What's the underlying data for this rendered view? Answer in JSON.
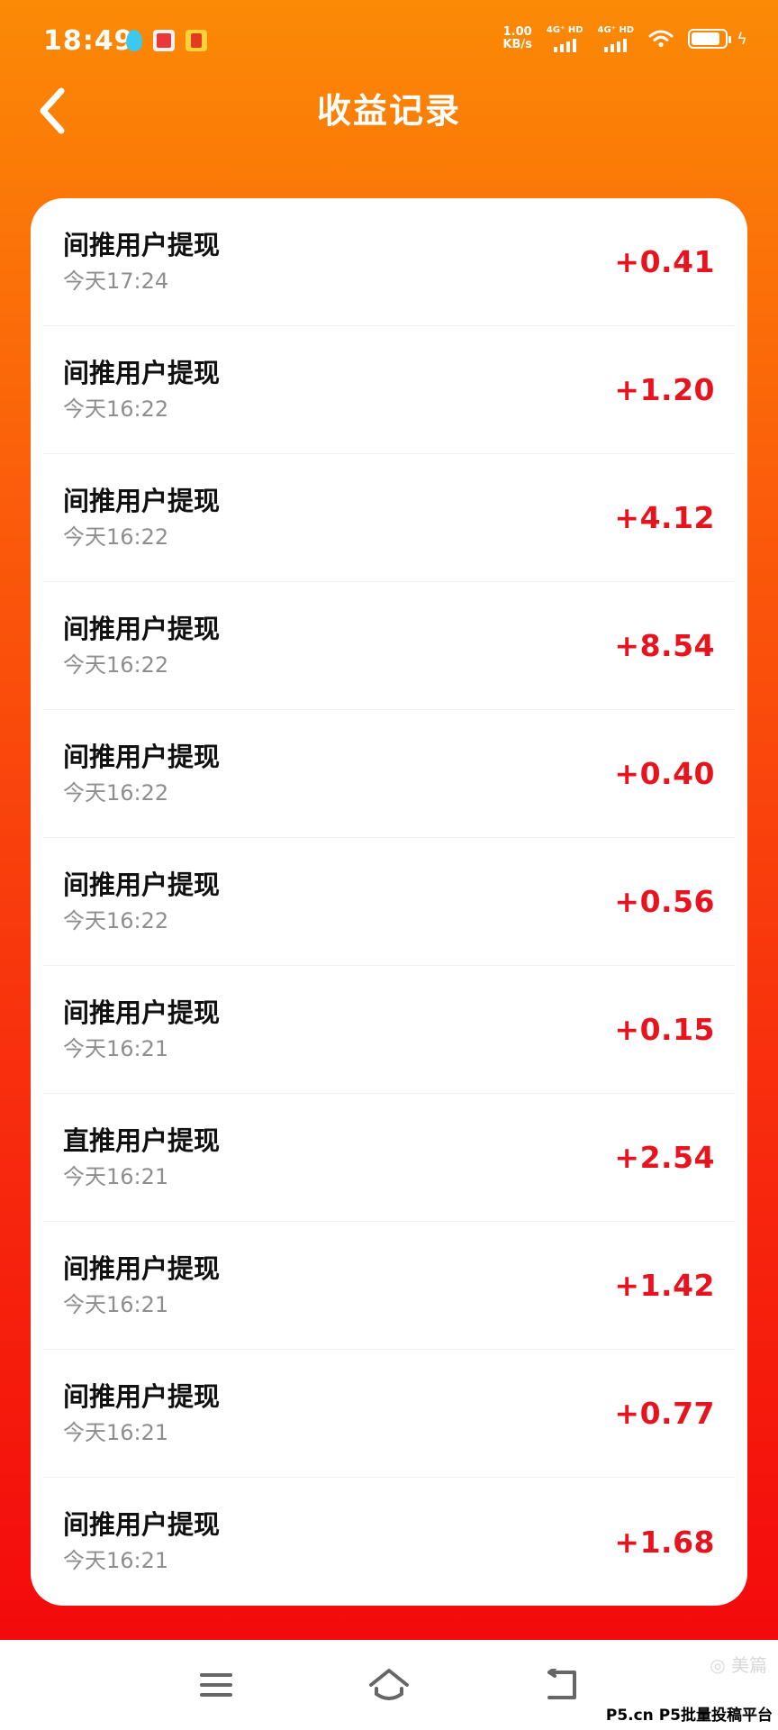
{
  "status_bar": {
    "time": "18:49",
    "net_speed_value": "1.00",
    "net_speed_unit": "KB/s",
    "sim1_label": "4G⁺ HD",
    "sim2_label": "4G⁺ HD",
    "battery_level": 0.85,
    "icons": [
      "water-drop-icon",
      "app-notification-icon",
      "app-notification-icon",
      "wifi-icon",
      "battery-icon",
      "charging-icon"
    ]
  },
  "header": {
    "title": "收益记录",
    "back_icon": "chevron-left-icon"
  },
  "records": [
    {
      "title": "间推用户提现",
      "time": "今天17:24",
      "amount": "+0.41"
    },
    {
      "title": "间推用户提现",
      "time": "今天16:22",
      "amount": "+1.20"
    },
    {
      "title": "间推用户提现",
      "time": "今天16:22",
      "amount": "+4.12"
    },
    {
      "title": "间推用户提现",
      "time": "今天16:22",
      "amount": "+8.54"
    },
    {
      "title": "间推用户提现",
      "time": "今天16:22",
      "amount": "+0.40"
    },
    {
      "title": "间推用户提现",
      "time": "今天16:22",
      "amount": "+0.56"
    },
    {
      "title": "间推用户提现",
      "time": "今天16:21",
      "amount": "+0.15"
    },
    {
      "title": "直推用户提现",
      "time": "今天16:21",
      "amount": "+2.54"
    },
    {
      "title": "间推用户提现",
      "time": "今天16:21",
      "amount": "+1.42"
    },
    {
      "title": "间推用户提现",
      "time": "今天16:21",
      "amount": "+0.77"
    },
    {
      "title": "间推用户提现",
      "time": "今天16:21",
      "amount": "+1.68"
    }
  ],
  "nav_bar": {
    "icons": [
      "menu-icon",
      "home-icon",
      "back-icon"
    ]
  },
  "watermark": {
    "logo_text": "美篇",
    "text": "P5.cn P5批量投稿平台"
  },
  "colors": {
    "gradient_top": "#fb8a06",
    "gradient_bottom": "#f30a0c",
    "amount": "#e5141e",
    "title_text": "#111111",
    "time_text": "#8e8e8e"
  }
}
